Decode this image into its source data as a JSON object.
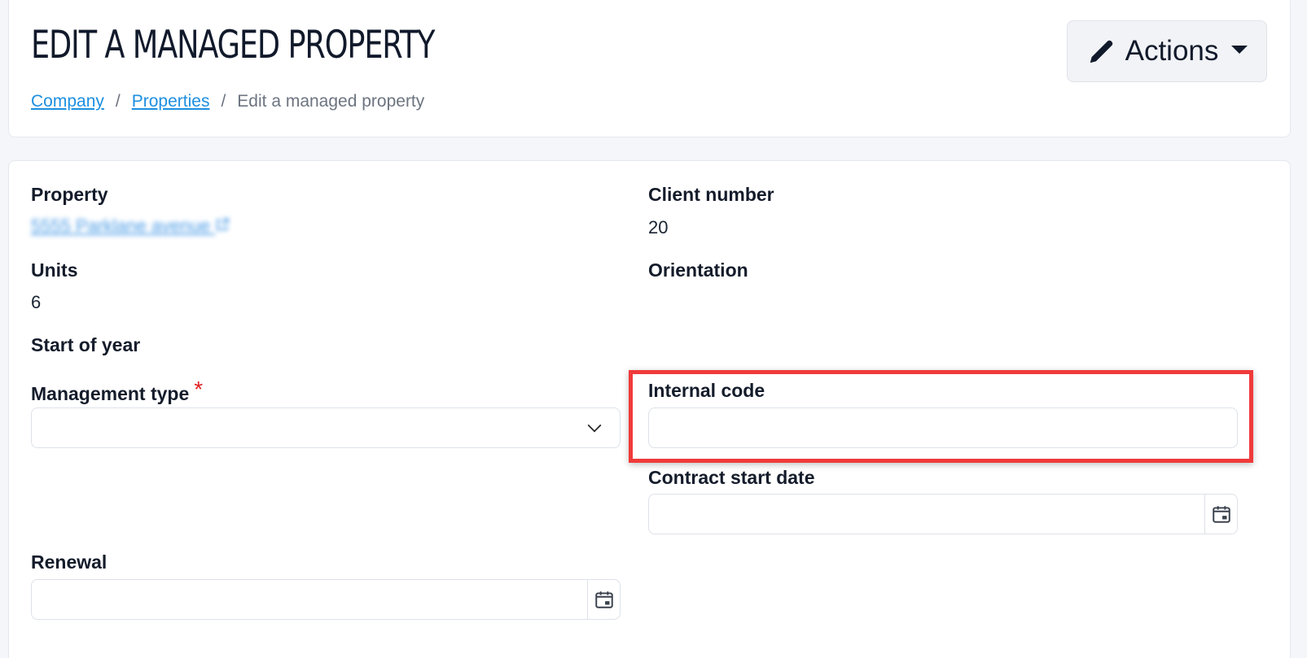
{
  "header": {
    "title": "EDIT A MANAGED PROPERTY",
    "actions_label": "Actions",
    "breadcrumb": {
      "company": "Company",
      "separator": "/",
      "properties": "Properties",
      "current": "Edit a managed property"
    }
  },
  "form": {
    "property": {
      "label": "Property",
      "value": "5555 Parklane avenue"
    },
    "client_number": {
      "label": "Client number",
      "value": "20"
    },
    "units": {
      "label": "Units",
      "value": "6"
    },
    "orientation": {
      "label": "Orientation",
      "value": ""
    },
    "start_of_year": {
      "label": "Start of year"
    },
    "management_type": {
      "label": "Management type",
      "required_mark": "*",
      "value": ""
    },
    "internal_code": {
      "label": "Internal code",
      "value": ""
    },
    "contract_start_date": {
      "label": "Contract start date",
      "value": ""
    },
    "renewal": {
      "label": "Renewal",
      "value": ""
    }
  },
  "colors": {
    "link": "#1d8fe0",
    "required": "#e02020",
    "highlight": "#f03a3a",
    "background": "#f4f6f9"
  },
  "icons": [
    "pencil-icon",
    "caret-down-icon",
    "external-link-icon",
    "chevron-down-icon",
    "calendar-icon"
  ]
}
